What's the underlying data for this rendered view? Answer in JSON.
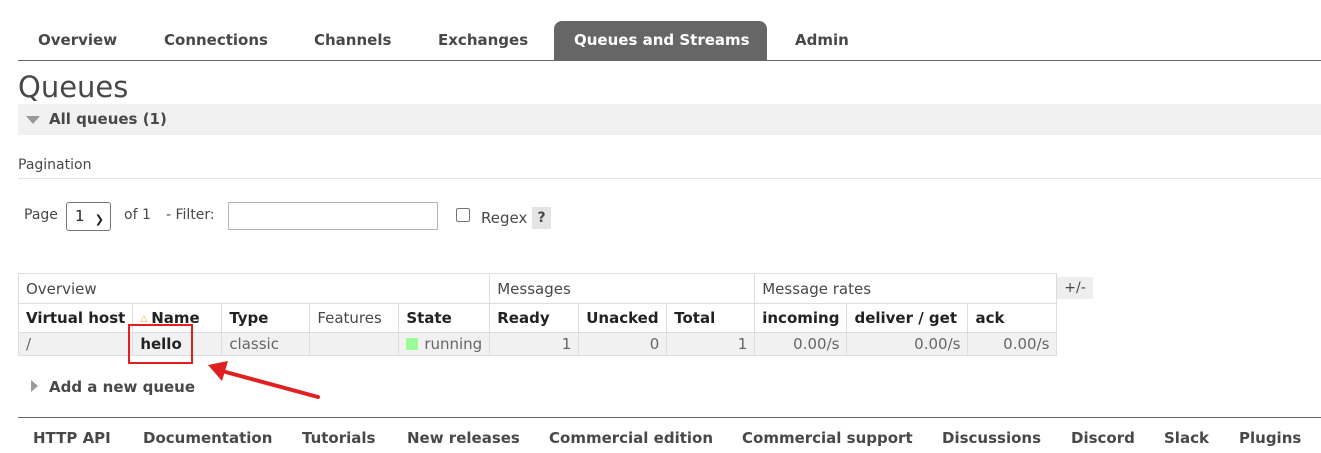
{
  "nav": {
    "tabs": [
      {
        "label": "Overview"
      },
      {
        "label": "Connections"
      },
      {
        "label": "Channels"
      },
      {
        "label": "Exchanges"
      },
      {
        "label": "Queues and Streams",
        "active": true
      },
      {
        "label": "Admin"
      }
    ]
  },
  "page": {
    "title": "Queues",
    "section_title": "All queues (1)"
  },
  "pagination": {
    "heading": "Pagination",
    "page_label": "Page",
    "page_value": "1",
    "of_label": "of 1",
    "filter_label": "- Filter:",
    "filter_value": "",
    "regex_label": "Regex",
    "regex_checked": false,
    "help_label": "?"
  },
  "table": {
    "groups": [
      "Overview",
      "Messages",
      "Message rates"
    ],
    "columns": [
      "Virtual host",
      "Name",
      "Type",
      "Features",
      "State",
      "Ready",
      "Unacked",
      "Total",
      "incoming",
      "deliver / get",
      "ack"
    ],
    "rows": [
      {
        "vhost": "/",
        "name": "hello",
        "type": "classic",
        "features": "",
        "state": "running",
        "ready": "1",
        "unacked": "0",
        "total": "1",
        "incoming": "0.00/s",
        "deliver_get": "0.00/s",
        "ack": "0.00/s"
      }
    ],
    "toggle_columns_label": "+/-"
  },
  "add_queue_label": "Add a new queue",
  "footer": {
    "links": [
      "HTTP API",
      "Documentation",
      "Tutorials",
      "New releases",
      "Commercial edition",
      "Commercial support",
      "Discussions",
      "Discord",
      "Slack",
      "Plugins"
    ]
  },
  "colors": {
    "active_tab": "#666666",
    "state_running": "#99ff99",
    "annotation": "#e02020"
  }
}
